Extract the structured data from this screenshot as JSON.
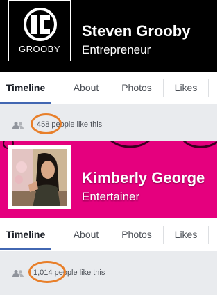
{
  "profile1": {
    "name": "Steven Grooby",
    "subtitle": "Entrepreneur",
    "logo_text": "GROOBY",
    "tabs": [
      "Timeline",
      "About",
      "Photos",
      "Likes"
    ],
    "active_tab": "Timeline",
    "likes_count": "458",
    "likes_suffix": " people like this",
    "cover_color": "#000000"
  },
  "profile2": {
    "name": "Kimberly George",
    "subtitle": "Entertainer",
    "tabs": [
      "Timeline",
      "About",
      "Photos",
      "Likes"
    ],
    "active_tab": "Timeline",
    "likes_count": "1,014",
    "likes_suffix": " people like this",
    "cover_color": "#e5007e"
  },
  "colors": {
    "accent": "#4267b2",
    "highlight_circle": "#e87f2a",
    "likes_bg": "#e9ebee"
  },
  "icons": [
    "grooby-logo",
    "people-icon",
    "profile-photo"
  ]
}
